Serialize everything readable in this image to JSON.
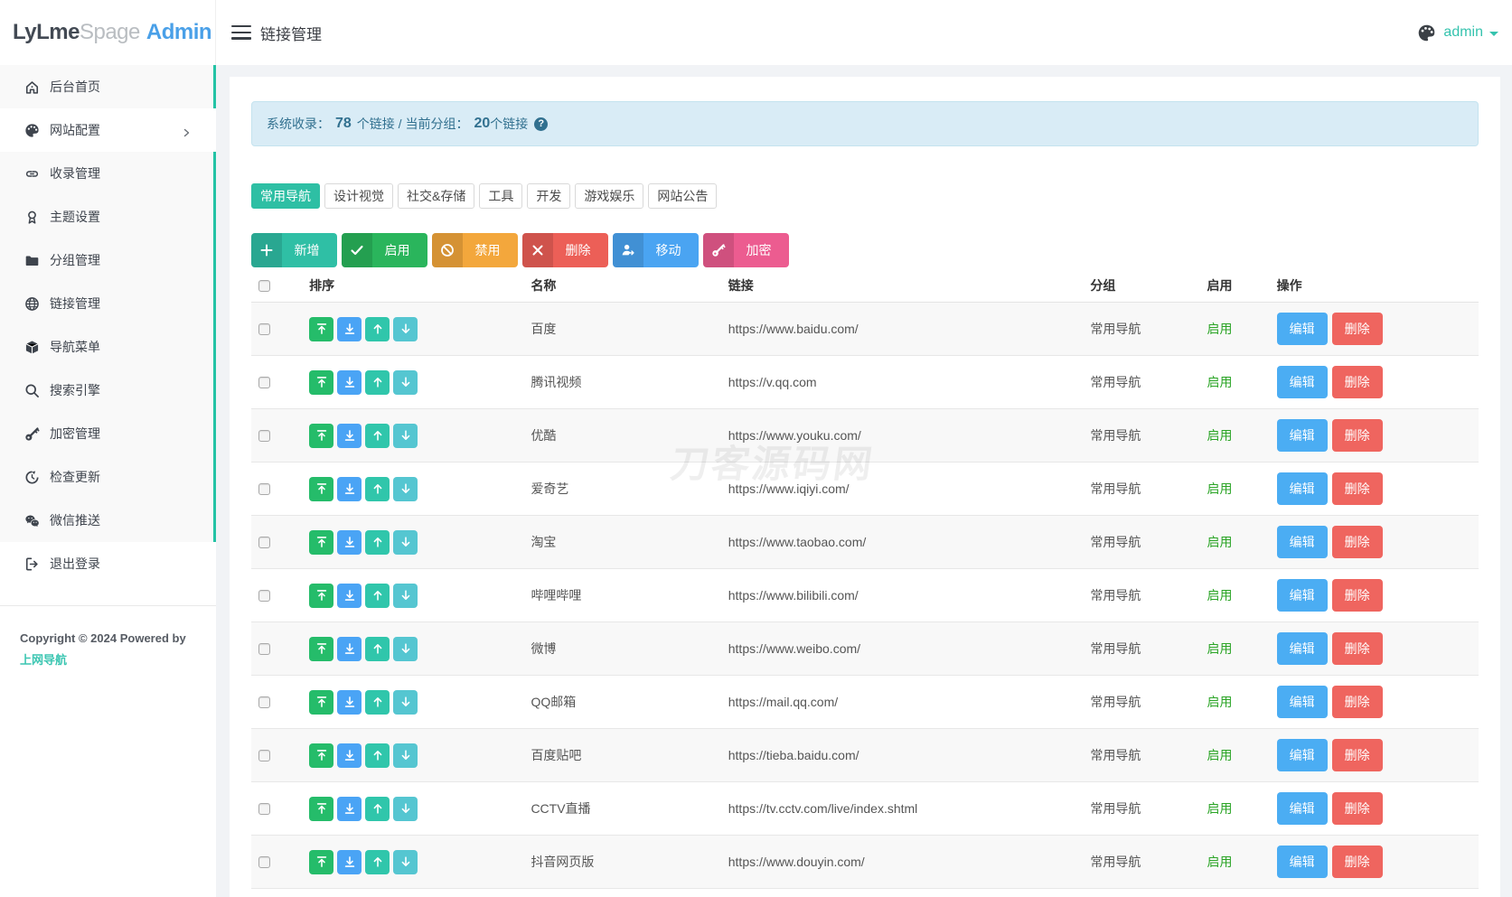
{
  "topbar": {
    "logo_lylme": "LyLme",
    "logo_spage": "Spage",
    "logo_admin": "Admin",
    "page_title": "链接管理",
    "username": "admin"
  },
  "sidebar": {
    "items": [
      {
        "label": "后台首页",
        "icon": "home"
      },
      {
        "label": "网站配置",
        "icon": "palette",
        "hover": true,
        "chevron": true
      },
      {
        "label": "收录管理",
        "icon": "link"
      },
      {
        "label": "主题设置",
        "icon": "award"
      },
      {
        "label": "分组管理",
        "icon": "folder"
      },
      {
        "label": "链接管理",
        "icon": "globe"
      },
      {
        "label": "导航菜单",
        "icon": "cube"
      },
      {
        "label": "搜索引擎",
        "icon": "search"
      },
      {
        "label": "加密管理",
        "icon": "key"
      },
      {
        "label": "检查更新",
        "icon": "refresh"
      },
      {
        "label": "微信推送",
        "icon": "wechat"
      }
    ],
    "logout": {
      "label": "退出登录",
      "icon": "logout"
    },
    "copyright_text": "Copyright © 2024 Powered by",
    "copyright_link": "上网导航"
  },
  "alert": {
    "label_total": "系统收录：",
    "total_count": "78",
    "mid_text": "个链接 / 当前分组：",
    "group_count": "20",
    "suffix": "个链接"
  },
  "group_tabs": [
    {
      "label": "常用导航",
      "active": true
    },
    {
      "label": "设计视觉",
      "active": false
    },
    {
      "label": "社交&存储",
      "active": false
    },
    {
      "label": "工具",
      "active": false
    },
    {
      "label": "开发",
      "active": false
    },
    {
      "label": "游戏娱乐",
      "active": false
    },
    {
      "label": "网站公告",
      "active": false
    }
  ],
  "toolbar_buttons": [
    {
      "label": "新增",
      "icon": "plus",
      "color": "#2fbfa5",
      "name": "add"
    },
    {
      "label": "启用",
      "icon": "check",
      "color": "#2ab55c",
      "name": "enable"
    },
    {
      "label": "禁用",
      "icon": "ban",
      "color": "#f3a73c",
      "name": "disable"
    },
    {
      "label": "删除",
      "icon": "cross",
      "color": "#ec5f57",
      "name": "delete"
    },
    {
      "label": "移动",
      "icon": "user-move",
      "color": "#4aa4f2",
      "name": "move"
    },
    {
      "label": "加密",
      "icon": "key-solid",
      "color": "#ec5c90",
      "name": "encrypt"
    }
  ],
  "table": {
    "headers": {
      "sort": "排序",
      "name": "名称",
      "url": "链接",
      "group": "分组",
      "enabled": "启用",
      "actions": "操作"
    },
    "sort_buttons": [
      {
        "icon": "to-top",
        "color": "#25bc6a",
        "name": "move-to-top"
      },
      {
        "icon": "to-bottom",
        "color": "#4aa4f5",
        "name": "move-to-bottom"
      },
      {
        "icon": "arrow-up",
        "color": "#30c6ab",
        "name": "move-up"
      },
      {
        "icon": "arrow-down",
        "color": "#55c6d1",
        "name": "move-down"
      }
    ],
    "edit_label": "编辑",
    "delete_label": "删除",
    "status_enabled": "启用",
    "rows": [
      {
        "name": "百度",
        "url": "https://www.baidu.com/",
        "group": "常用导航",
        "status": "启用"
      },
      {
        "name": "腾讯视频",
        "url": "https://v.qq.com",
        "group": "常用导航",
        "status": "启用"
      },
      {
        "name": "优酷",
        "url": "https://www.youku.com/",
        "group": "常用导航",
        "status": "启用"
      },
      {
        "name": "爱奇艺",
        "url": "https://www.iqiyi.com/",
        "group": "常用导航",
        "status": "启用"
      },
      {
        "name": "淘宝",
        "url": "https://www.taobao.com/",
        "group": "常用导航",
        "status": "启用"
      },
      {
        "name": "哔哩哔哩",
        "url": "https://www.bilibili.com/",
        "group": "常用导航",
        "status": "启用"
      },
      {
        "name": "微博",
        "url": "https://www.weibo.com/",
        "group": "常用导航",
        "status": "启用"
      },
      {
        "name": "QQ邮箱",
        "url": "https://mail.qq.com/",
        "group": "常用导航",
        "status": "启用"
      },
      {
        "name": "百度贴吧",
        "url": "https://tieba.baidu.com/",
        "group": "常用导航",
        "status": "启用"
      },
      {
        "name": "CCTV直播",
        "url": "https://tv.cctv.com/live/index.shtml",
        "group": "常用导航",
        "status": "启用"
      },
      {
        "name": "抖音网页版",
        "url": "https://www.douyin.com/",
        "group": "常用导航",
        "status": "启用"
      }
    ]
  },
  "watermark": "刀客源码网",
  "colors": {
    "theme_teal": "#2ebfa4",
    "sidebar_border_teal": "#23c3a5",
    "admin_link_teal": "#35c3ae",
    "logo_blue": "#4aa0e8",
    "alert_bg": "#d9ecf6",
    "alert_text": "#31708f",
    "status_green": "#2aa425",
    "edit_blue": "#4badf3",
    "delete_red": "#ef655f",
    "page_bg": "#f1f3f6"
  }
}
